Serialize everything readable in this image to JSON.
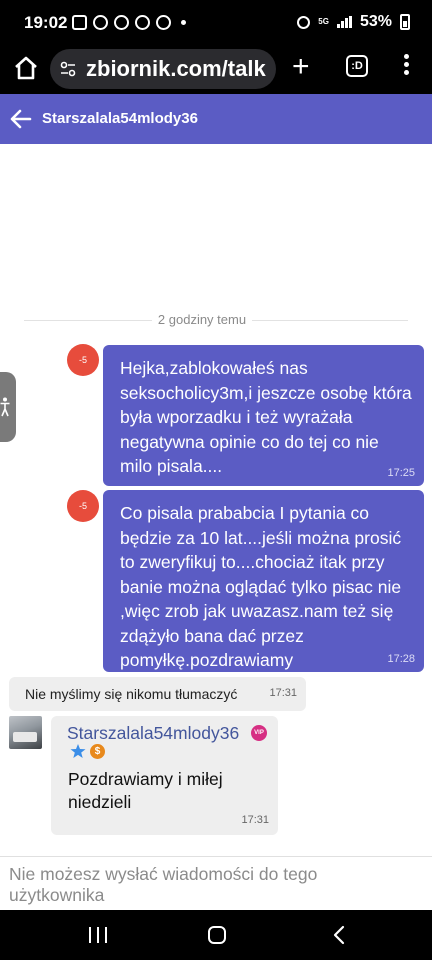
{
  "status_bar": {
    "time": "19:02",
    "network": "5G",
    "battery": "53%"
  },
  "browser": {
    "url": "zbiornik.com/talk",
    "tabs_count": ":D"
  },
  "chat": {
    "title": "Starszalala54mlody36",
    "separator": "2 godziny temu"
  },
  "messages": {
    "m1": {
      "badge": "-5",
      "text": "Hejka,zablokowałeś nas seksocholicy3m,i jeszcze osobę która była wporzadku i też wyrażała negatywna opinie co do tej co nie milo pisala....",
      "time": "17:25"
    },
    "m2": {
      "badge": "-5",
      "text": "Co pisala prababcia I pytania co będzie za 10 lat....jeśli można prosić to zweryfikuj to....chociaż itak przy banie można oglądać tylko pisac nie ,więc zrob jak uwazasz.nam też się zdążyło bana dać przez pomyłkę.pozdrawiamy",
      "time": "17:28"
    },
    "m3": {
      "text": "Nie myślimy się nikomu tłumaczyć",
      "time": "17:31"
    },
    "m4": {
      "name": "Starszalala54mlody36",
      "vip": "VIP",
      "coin": "$",
      "text": "Pozdrawiamy i miłej niedzieli",
      "time": "17:31"
    }
  },
  "footer": {
    "notice": "Nie możesz wysłać wiadomości do tego użytkownika"
  },
  "colors": {
    "accent": "#5b5cc4",
    "badge": "#e74c3c",
    "vip": "#d62f83",
    "coin": "#e8891c"
  }
}
